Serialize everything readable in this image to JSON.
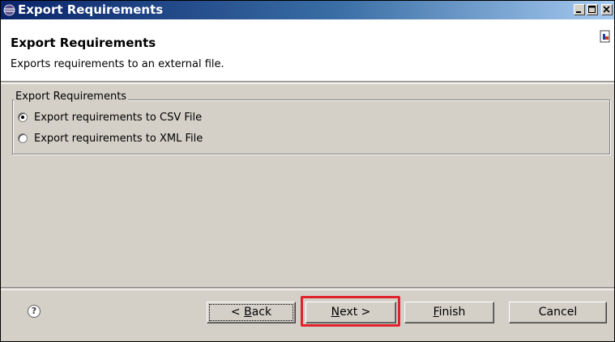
{
  "window": {
    "title": "Export Requirements",
    "controls": [
      "minimize",
      "maximize",
      "close"
    ]
  },
  "banner": {
    "title": "Export Requirements",
    "description": "Exports requirements to an external file."
  },
  "group": {
    "legend": "Export Requirements",
    "options": [
      {
        "label": "Export requirements to CSV File",
        "selected": true
      },
      {
        "label": "Export requirements to XML File",
        "selected": false
      }
    ]
  },
  "buttons": {
    "back": {
      "mnemonic": "B",
      "prefix": "< ",
      "rest": "ack"
    },
    "next": {
      "mnemonic": "N",
      "rest": "ext >"
    },
    "finish": {
      "mnemonic": "F",
      "rest": "inish"
    },
    "cancel": {
      "label": "Cancel"
    }
  },
  "help_glyph": "?",
  "colors": {
    "highlight": "#e0222b",
    "titlebar": "#0a246a",
    "dialog": "#d4d0c8"
  }
}
